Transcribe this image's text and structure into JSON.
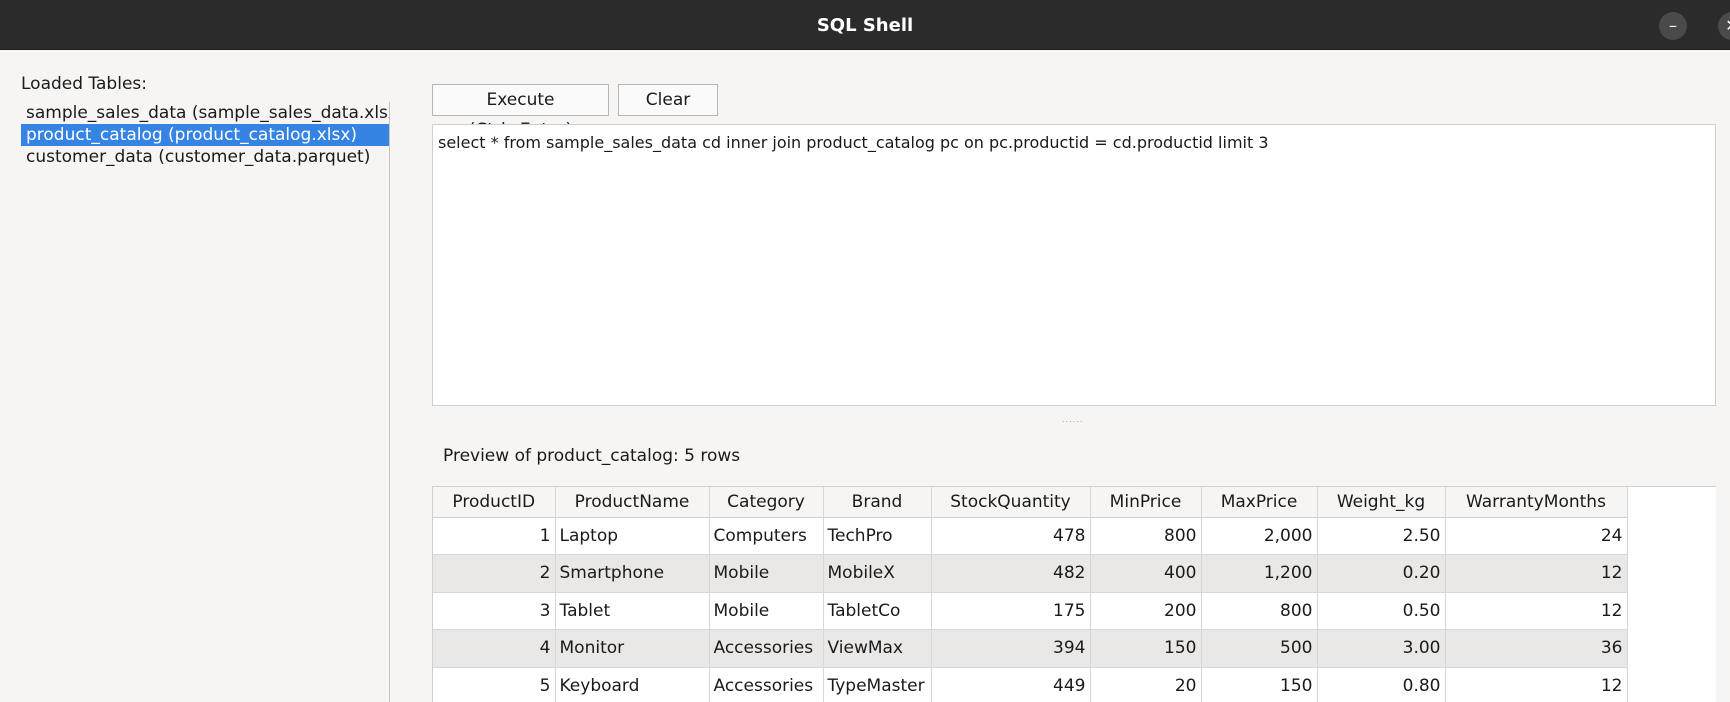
{
  "window": {
    "title": "SQL Shell",
    "minimize_icon": "–",
    "close_icon": "✕"
  },
  "sidebar": {
    "label": "Loaded Tables:",
    "tables": [
      "sample_sales_data (sample_sales_data.xlsx",
      "product_catalog (product_catalog.xlsx)",
      "customer_data (customer_data.parquet)"
    ],
    "selected_index": 1
  },
  "toolbar": {
    "execute_label": "Execute (Ctrl+Enter)",
    "clear_label": "Clear"
  },
  "editor": {
    "query": "select * from sample_sales_data cd inner join product_catalog pc on pc.productid = cd.productid limit 3"
  },
  "splitter": {
    "handle": "......"
  },
  "results": {
    "preview_label": "Preview of product_catalog:  5 rows",
    "columns": [
      "ProductID",
      "ProductName",
      "Category",
      "Brand",
      "StockQuantity",
      "MinPrice",
      "MaxPrice",
      "Weight_kg",
      "WarrantyMonths"
    ],
    "rows": [
      [
        "1",
        "Laptop",
        "Computers",
        "TechPro",
        "478",
        "800",
        "2,000",
        "2.50",
        "24"
      ],
      [
        "2",
        "Smartphone",
        "Mobile",
        "MobileX",
        "482",
        "400",
        "1,200",
        "0.20",
        "12"
      ],
      [
        "3",
        "Tablet",
        "Mobile",
        "TabletCo",
        "175",
        "200",
        "800",
        "0.50",
        "12"
      ],
      [
        "4",
        "Monitor",
        "Accessories",
        "ViewMax",
        "394",
        "150",
        "500",
        "3.00",
        "36"
      ],
      [
        "5",
        "Keyboard",
        "Accessories",
        "TypeMaster",
        "449",
        "20",
        "150",
        "0.80",
        "12"
      ]
    ]
  },
  "colors": {
    "titlebar": "#2b2b2b",
    "selection": "#3584e4",
    "alt_row": "#e9e8e7"
  }
}
